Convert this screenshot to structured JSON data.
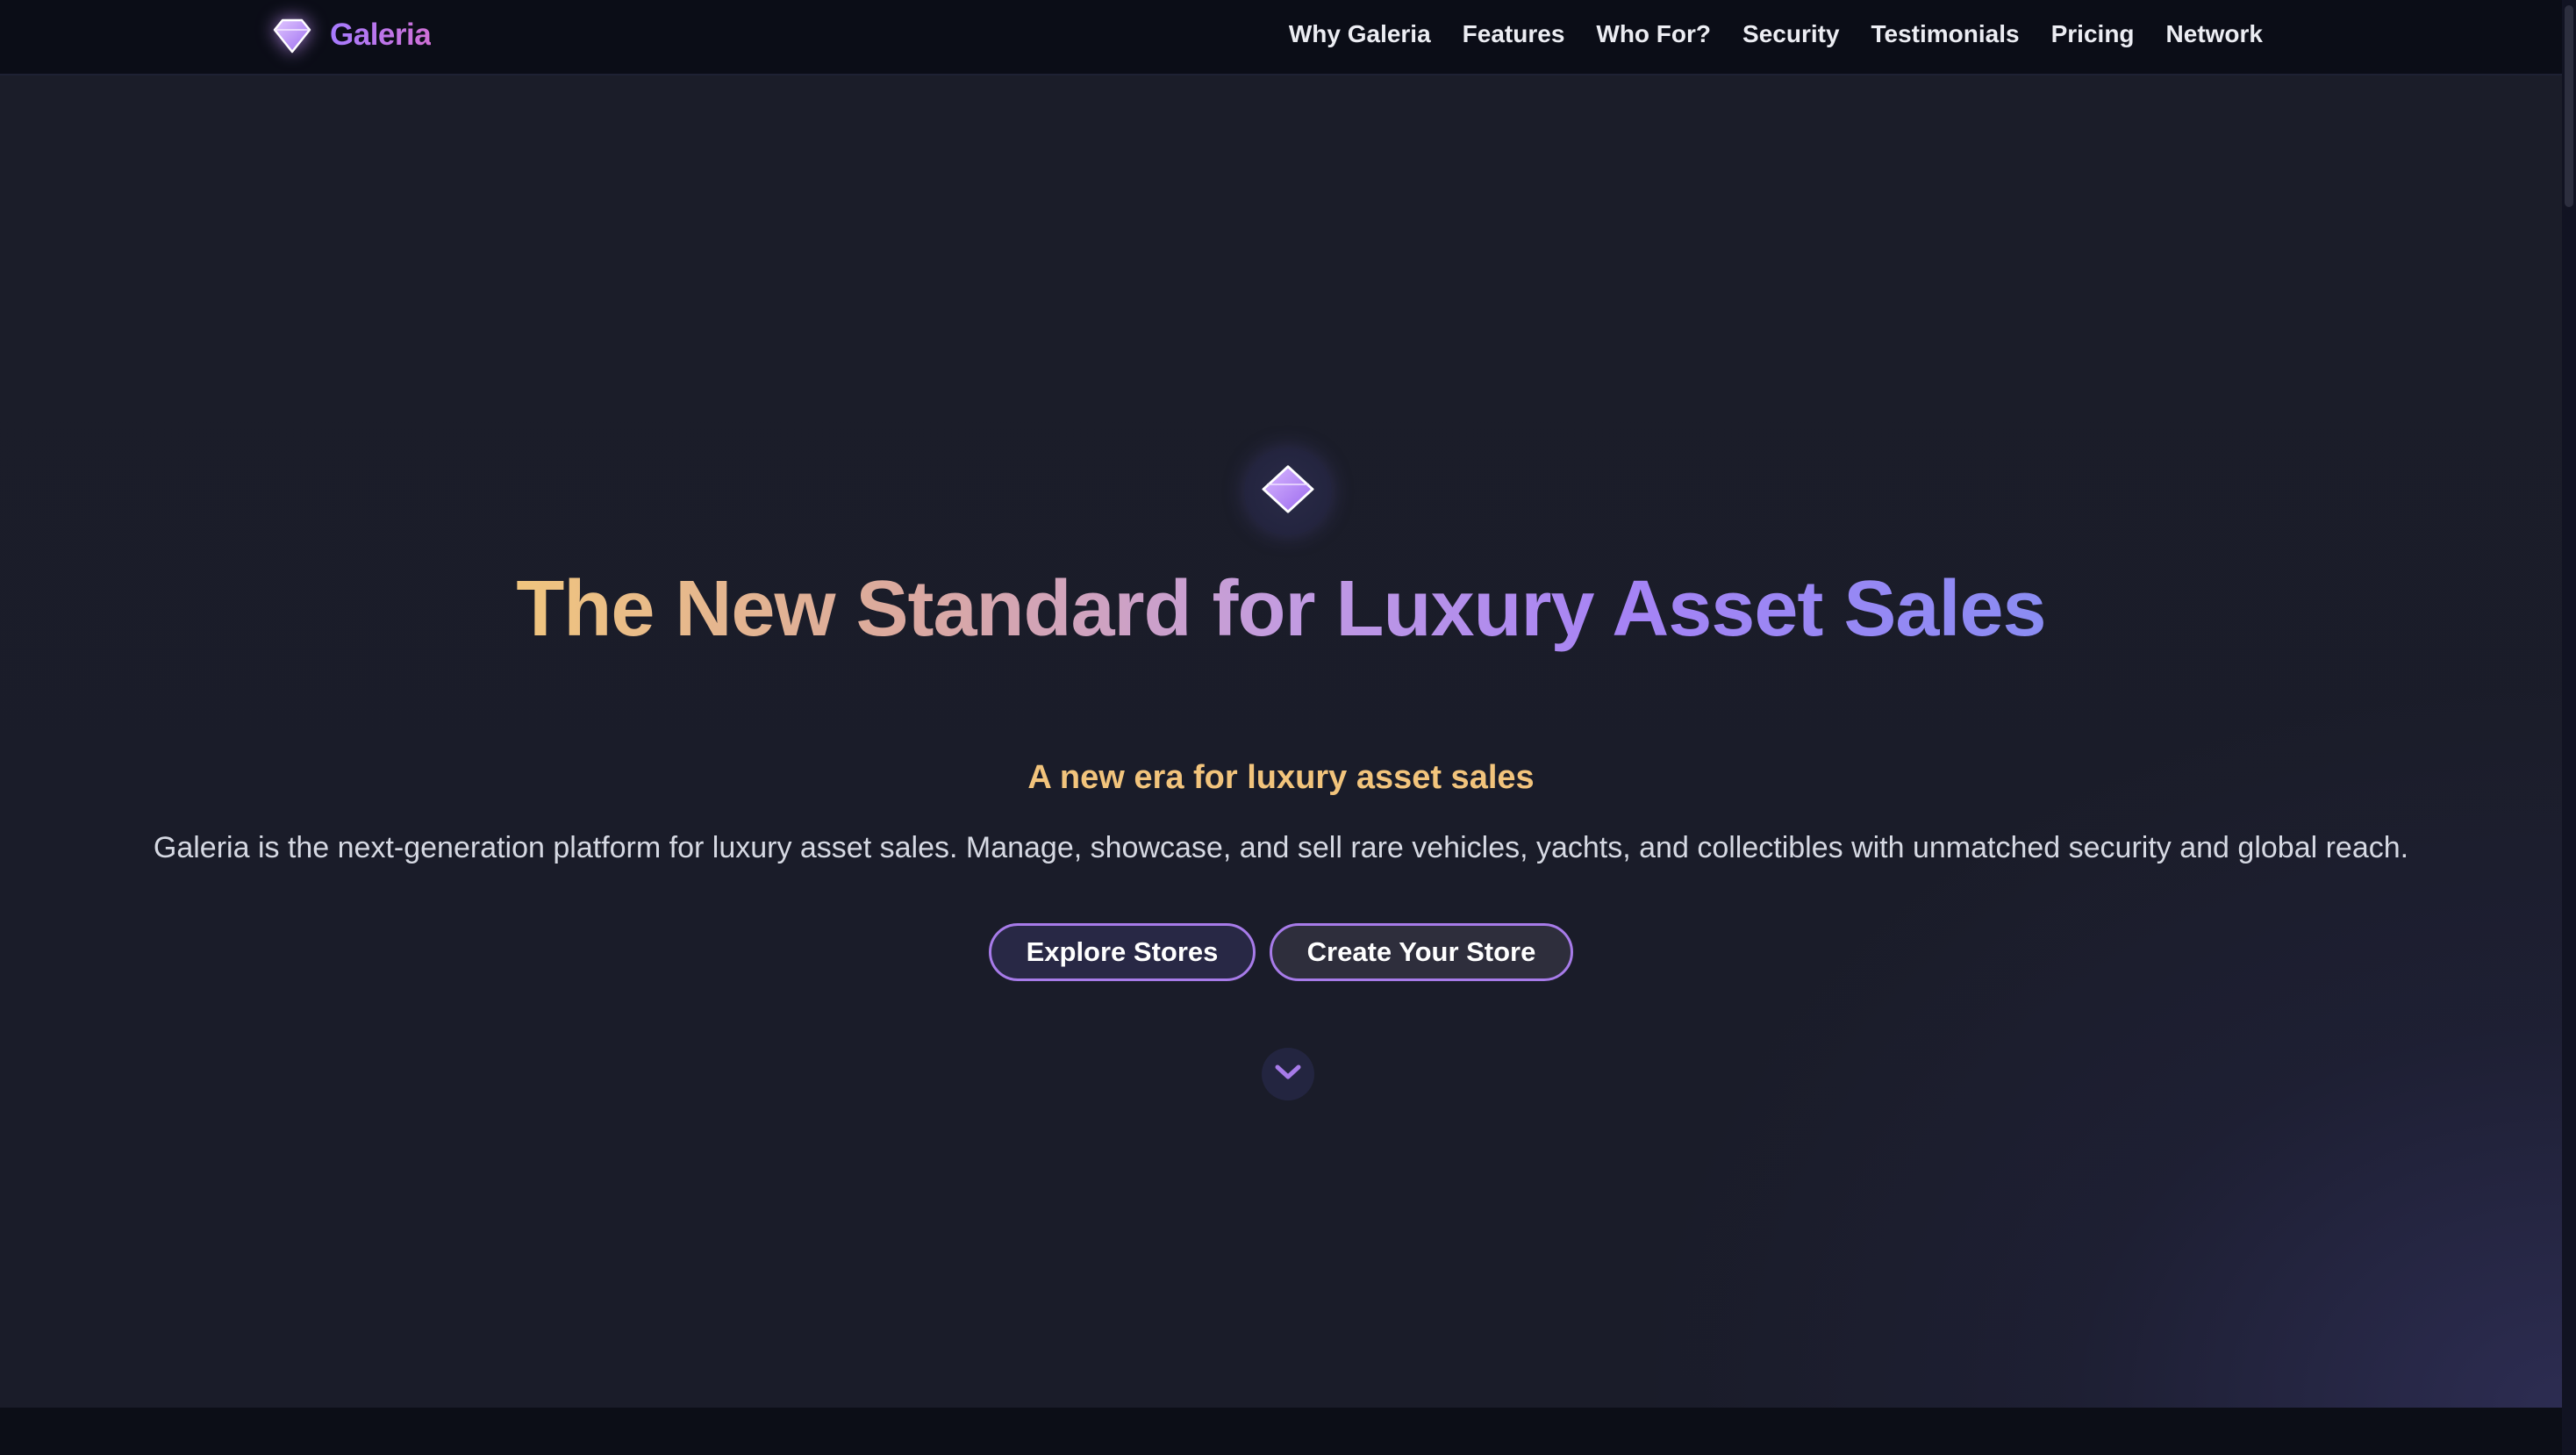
{
  "brand": {
    "name": "Galeria",
    "icon": "diamond-icon"
  },
  "nav": {
    "items": [
      {
        "label": "Why Galeria"
      },
      {
        "label": "Features"
      },
      {
        "label": "Who For?"
      },
      {
        "label": "Security"
      },
      {
        "label": "Testimonials"
      },
      {
        "label": "Pricing"
      },
      {
        "label": "Network"
      }
    ]
  },
  "hero": {
    "icon": "diamond-icon",
    "title": "The New Standard for Luxury Asset Sales",
    "tagline": "A new era for luxury asset sales",
    "description": "Galeria is the next-generation platform for luxury asset sales. Manage, showcase, and sell rare vehicles, yachts, and collectibles with unmatched security and global reach.",
    "buttons": {
      "explore": "Explore Stores",
      "create": "Create Your Store"
    },
    "scroll_icon": "chevron-down-icon"
  },
  "colors": {
    "background": "#1b1d2a",
    "navbar": "#0b0d17",
    "accent_purple": "#a77be9",
    "accent_gold": "#f2c47c",
    "text": "#ecedf3"
  }
}
